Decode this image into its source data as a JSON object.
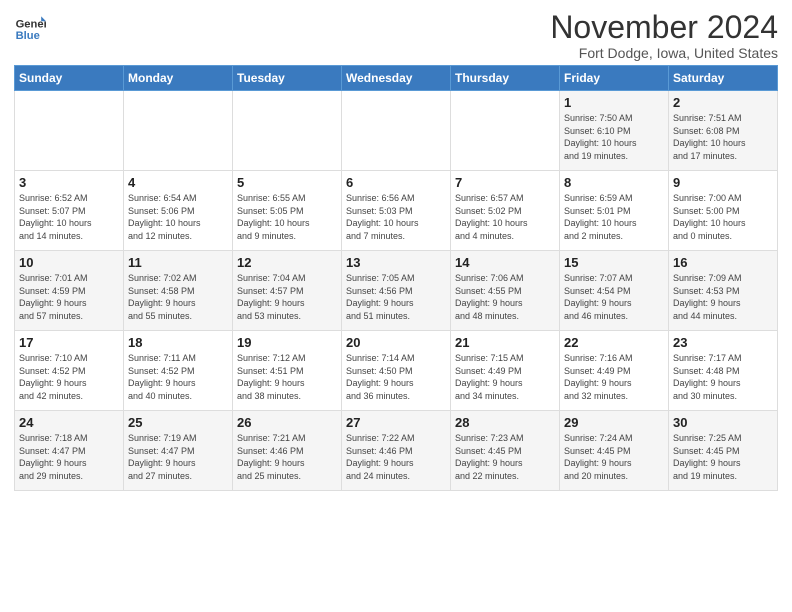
{
  "header": {
    "logo_general": "General",
    "logo_blue": "Blue",
    "month_title": "November 2024",
    "location": "Fort Dodge, Iowa, United States"
  },
  "weekdays": [
    "Sunday",
    "Monday",
    "Tuesday",
    "Wednesday",
    "Thursday",
    "Friday",
    "Saturday"
  ],
  "weeks": [
    [
      {
        "day": "",
        "info": ""
      },
      {
        "day": "",
        "info": ""
      },
      {
        "day": "",
        "info": ""
      },
      {
        "day": "",
        "info": ""
      },
      {
        "day": "",
        "info": ""
      },
      {
        "day": "1",
        "info": "Sunrise: 7:50 AM\nSunset: 6:10 PM\nDaylight: 10 hours\nand 19 minutes."
      },
      {
        "day": "2",
        "info": "Sunrise: 7:51 AM\nSunset: 6:08 PM\nDaylight: 10 hours\nand 17 minutes."
      }
    ],
    [
      {
        "day": "3",
        "info": "Sunrise: 6:52 AM\nSunset: 5:07 PM\nDaylight: 10 hours\nand 14 minutes."
      },
      {
        "day": "4",
        "info": "Sunrise: 6:54 AM\nSunset: 5:06 PM\nDaylight: 10 hours\nand 12 minutes."
      },
      {
        "day": "5",
        "info": "Sunrise: 6:55 AM\nSunset: 5:05 PM\nDaylight: 10 hours\nand 9 minutes."
      },
      {
        "day": "6",
        "info": "Sunrise: 6:56 AM\nSunset: 5:03 PM\nDaylight: 10 hours\nand 7 minutes."
      },
      {
        "day": "7",
        "info": "Sunrise: 6:57 AM\nSunset: 5:02 PM\nDaylight: 10 hours\nand 4 minutes."
      },
      {
        "day": "8",
        "info": "Sunrise: 6:59 AM\nSunset: 5:01 PM\nDaylight: 10 hours\nand 2 minutes."
      },
      {
        "day": "9",
        "info": "Sunrise: 7:00 AM\nSunset: 5:00 PM\nDaylight: 10 hours\nand 0 minutes."
      }
    ],
    [
      {
        "day": "10",
        "info": "Sunrise: 7:01 AM\nSunset: 4:59 PM\nDaylight: 9 hours\nand 57 minutes."
      },
      {
        "day": "11",
        "info": "Sunrise: 7:02 AM\nSunset: 4:58 PM\nDaylight: 9 hours\nand 55 minutes."
      },
      {
        "day": "12",
        "info": "Sunrise: 7:04 AM\nSunset: 4:57 PM\nDaylight: 9 hours\nand 53 minutes."
      },
      {
        "day": "13",
        "info": "Sunrise: 7:05 AM\nSunset: 4:56 PM\nDaylight: 9 hours\nand 51 minutes."
      },
      {
        "day": "14",
        "info": "Sunrise: 7:06 AM\nSunset: 4:55 PM\nDaylight: 9 hours\nand 48 minutes."
      },
      {
        "day": "15",
        "info": "Sunrise: 7:07 AM\nSunset: 4:54 PM\nDaylight: 9 hours\nand 46 minutes."
      },
      {
        "day": "16",
        "info": "Sunrise: 7:09 AM\nSunset: 4:53 PM\nDaylight: 9 hours\nand 44 minutes."
      }
    ],
    [
      {
        "day": "17",
        "info": "Sunrise: 7:10 AM\nSunset: 4:52 PM\nDaylight: 9 hours\nand 42 minutes."
      },
      {
        "day": "18",
        "info": "Sunrise: 7:11 AM\nSunset: 4:52 PM\nDaylight: 9 hours\nand 40 minutes."
      },
      {
        "day": "19",
        "info": "Sunrise: 7:12 AM\nSunset: 4:51 PM\nDaylight: 9 hours\nand 38 minutes."
      },
      {
        "day": "20",
        "info": "Sunrise: 7:14 AM\nSunset: 4:50 PM\nDaylight: 9 hours\nand 36 minutes."
      },
      {
        "day": "21",
        "info": "Sunrise: 7:15 AM\nSunset: 4:49 PM\nDaylight: 9 hours\nand 34 minutes."
      },
      {
        "day": "22",
        "info": "Sunrise: 7:16 AM\nSunset: 4:49 PM\nDaylight: 9 hours\nand 32 minutes."
      },
      {
        "day": "23",
        "info": "Sunrise: 7:17 AM\nSunset: 4:48 PM\nDaylight: 9 hours\nand 30 minutes."
      }
    ],
    [
      {
        "day": "24",
        "info": "Sunrise: 7:18 AM\nSunset: 4:47 PM\nDaylight: 9 hours\nand 29 minutes."
      },
      {
        "day": "25",
        "info": "Sunrise: 7:19 AM\nSunset: 4:47 PM\nDaylight: 9 hours\nand 27 minutes."
      },
      {
        "day": "26",
        "info": "Sunrise: 7:21 AM\nSunset: 4:46 PM\nDaylight: 9 hours\nand 25 minutes."
      },
      {
        "day": "27",
        "info": "Sunrise: 7:22 AM\nSunset: 4:46 PM\nDaylight: 9 hours\nand 24 minutes."
      },
      {
        "day": "28",
        "info": "Sunrise: 7:23 AM\nSunset: 4:45 PM\nDaylight: 9 hours\nand 22 minutes."
      },
      {
        "day": "29",
        "info": "Sunrise: 7:24 AM\nSunset: 4:45 PM\nDaylight: 9 hours\nand 20 minutes."
      },
      {
        "day": "30",
        "info": "Sunrise: 7:25 AM\nSunset: 4:45 PM\nDaylight: 9 hours\nand 19 minutes."
      }
    ]
  ]
}
